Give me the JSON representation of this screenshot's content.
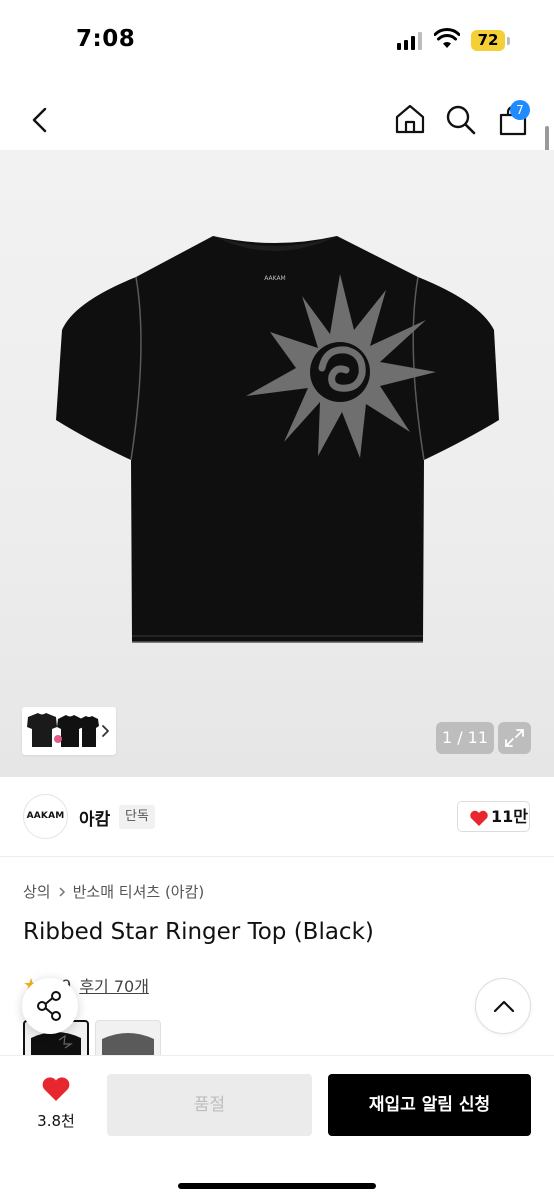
{
  "status_bar": {
    "time": "7:08",
    "battery": "72"
  },
  "nav": {
    "cart_badge": "7",
    "icons": [
      "back-icon",
      "home-icon",
      "search-icon",
      "cart-icon"
    ]
  },
  "gallery": {
    "pager": "1 / 11",
    "icons": [
      "expand-icon",
      "chevron-right-icon"
    ],
    "tshirt_logo": "AAKAM"
  },
  "brand": {
    "logo_text": "AAKAM",
    "name": "아캄",
    "badge": "단독",
    "like_count": "11만",
    "colors": {
      "heart": "#e8262f"
    }
  },
  "product": {
    "breadcrumb": [
      "상의",
      "반소매 티셔츠 (아캄)"
    ],
    "title": "Ribbed Star Ringer Top (Black)",
    "rating_partial": "9",
    "reviews": "후기 70개"
  },
  "bottom": {
    "wish_count": "3.8천",
    "soldout_label": "품절",
    "restock_label": "재입고 알림 신청"
  }
}
